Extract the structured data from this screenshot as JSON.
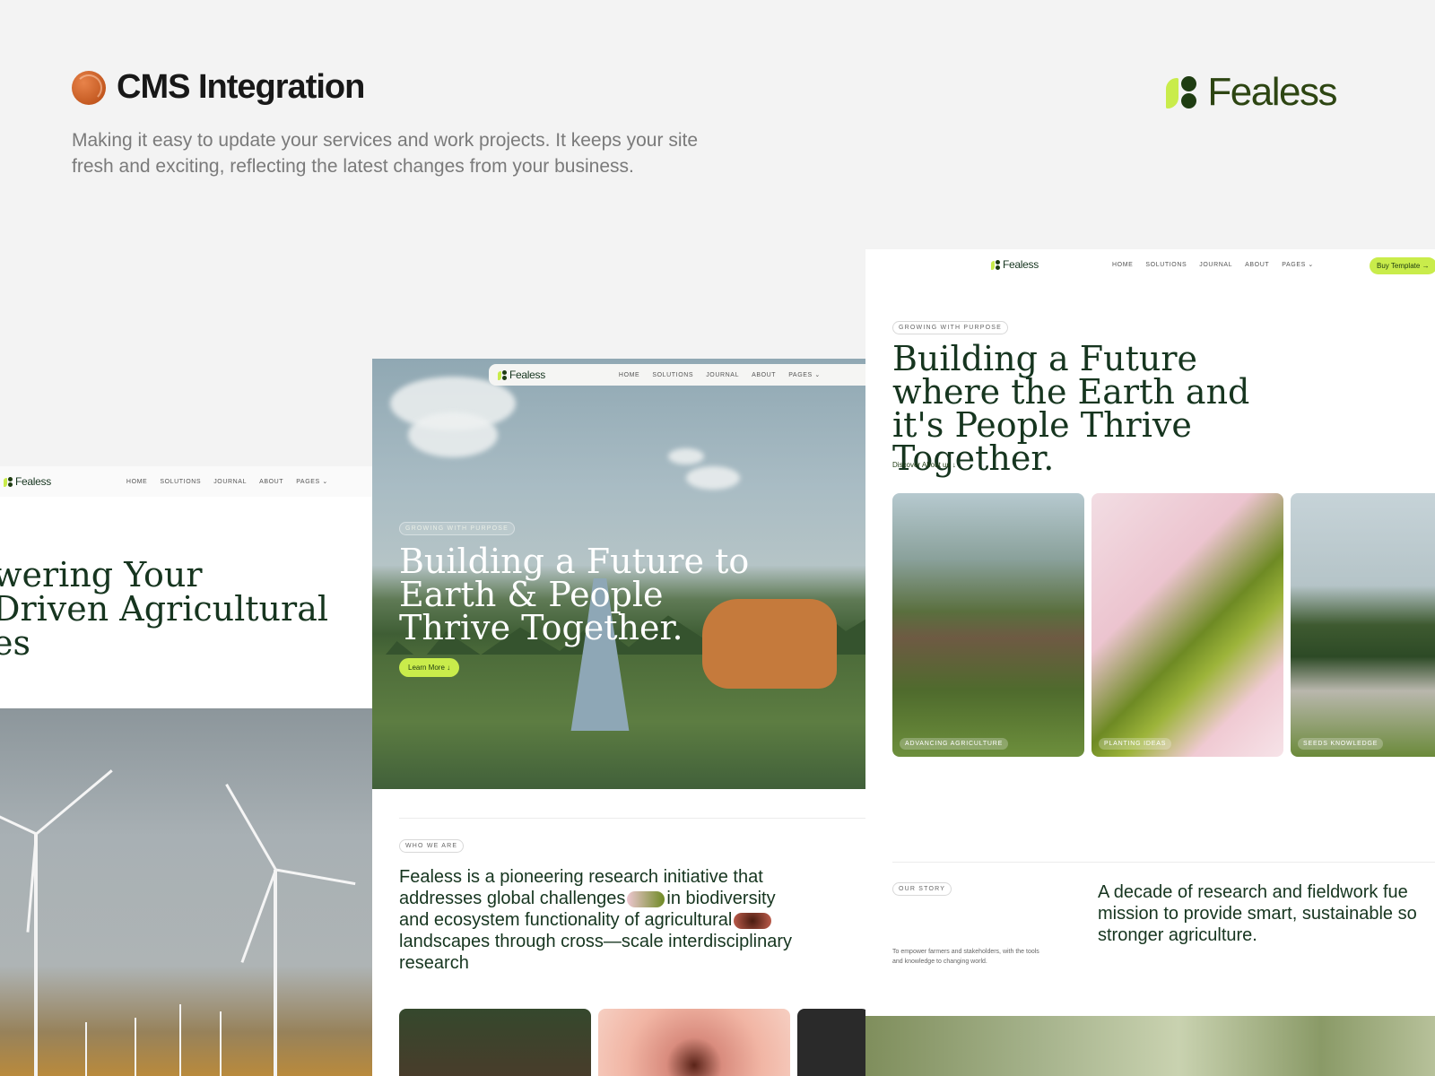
{
  "header": {
    "title": "CMS Integration",
    "description": "Making it easy to update your services and work projects. It keeps your site fresh and exciting, reflecting the latest changes from your business.",
    "brand": "Fealess"
  },
  "nav": {
    "logo": "Fealess",
    "items": [
      "HOME",
      "SOLUTIONS",
      "JOURNAL",
      "ABOUT",
      "PAGES"
    ]
  },
  "left_card": {
    "headline": "wering Your\nDriven Agricultural\nes"
  },
  "mid_card": {
    "eyebrow": "GROWING WITH PURPOSE",
    "headline": "Building a Future to Earth & People Thrive Together.",
    "cta": "Learn More",
    "section_label": "WHO WE ARE",
    "body_a": "Fealess is a pioneering research initiative that addresses global challenges",
    "body_b": "in biodiversity and ecosystem functionality of agricultural",
    "body_c": "landscapes through cross—scale interdisciplinary research"
  },
  "right_card": {
    "buy": "Buy Template",
    "eyebrow": "GROWING WITH PURPOSE",
    "headline": "Building a Future where the Earth and it's People Thrive Together.",
    "discover": "Discover About us",
    "cards": [
      "ADVANCING AGRICULTURE",
      "PLANTING IDEAS",
      "SEEDS KNOWLEDGE"
    ],
    "story_label": "OUR STORY",
    "story_small": "To empower farmers and stakeholders, with the tools and knowledge to changing world.",
    "story_line1": "A decade of research and fieldwork fue",
    "story_line2": "mission to provide smart, sustainable so",
    "story_line3": "stronger agriculture."
  },
  "colors": {
    "accent": "#c9ec4b",
    "dark_green": "#16351f",
    "background": "#f3f3f3"
  }
}
